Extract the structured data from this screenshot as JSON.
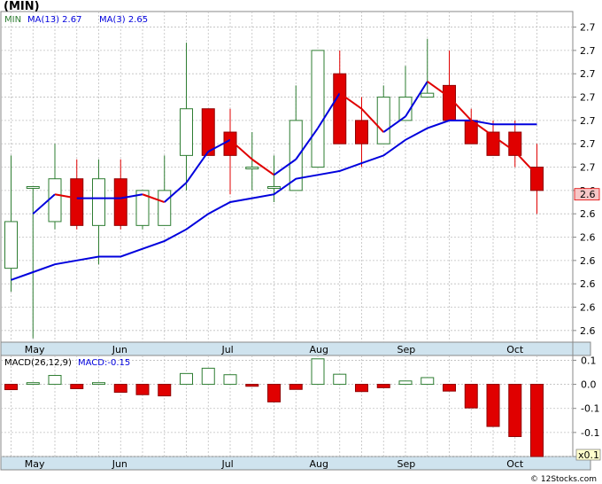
{
  "title": "(MIN)",
  "watermark": "© 12Stocks.com",
  "colors": {
    "up": "#2e7d32",
    "down": "#e00000",
    "ma13": "#0000dd",
    "ma3": "#e00000",
    "grid": "#bfbfbf",
    "axis_band": "#cfe3ee"
  },
  "chart_data": [
    {
      "type": "candlestick",
      "legend": [
        {
          "label": "MIN",
          "color": "#2e7d32"
        },
        {
          "label": "MA(13)",
          "value": "2.67",
          "color": "#0000dd"
        },
        {
          "label": "MA(3)",
          "value": "2.65",
          "color": "#0000dd"
        }
      ],
      "y_tick_labels": [
        "2.7",
        "2.7",
        "2.7",
        "2.7",
        "2.7",
        "2.7",
        "2.7",
        "2.6",
        "2.6",
        "2.6",
        "2.6",
        "2.6",
        "2.6",
        "2.6"
      ],
      "y_tick_values": [
        2.708,
        2.702,
        2.696,
        2.69,
        2.684,
        2.678,
        2.672,
        2.666,
        2.66,
        2.654,
        2.648,
        2.642,
        2.636,
        2.63
      ],
      "ylim": [
        2.627,
        2.712
      ],
      "last_price_label": "2.6",
      "last_price_value": 2.665,
      "x_tick_labels": [
        "May",
        "Jun",
        "Jul",
        "Aug",
        "Sep",
        "Oct"
      ],
      "x_tick_index": [
        1.1,
        5.1,
        10.1,
        14.1,
        18.1,
        23.1
      ],
      "candles": [
        {
          "o": 2.646,
          "h": 2.675,
          "l": 2.64,
          "c": 2.658
        },
        {
          "o": 2.667,
          "h": 2.667,
          "l": 2.628,
          "c": 2.667
        },
        {
          "o": 2.658,
          "h": 2.678,
          "l": 2.656,
          "c": 2.669
        },
        {
          "o": 2.669,
          "h": 2.674,
          "l": 2.656,
          "c": 2.657
        },
        {
          "o": 2.657,
          "h": 2.674,
          "l": 2.647,
          "c": 2.669
        },
        {
          "o": 2.669,
          "h": 2.674,
          "l": 2.656,
          "c": 2.657
        },
        {
          "o": 2.657,
          "h": 2.666,
          "l": 2.656,
          "c": 2.666
        },
        {
          "o": 2.657,
          "h": 2.675,
          "l": 2.657,
          "c": 2.666
        },
        {
          "o": 2.675,
          "h": 2.704,
          "l": 2.666,
          "c": 2.687
        },
        {
          "o": 2.687,
          "h": 2.687,
          "l": 2.675,
          "c": 2.675
        },
        {
          "o": 2.681,
          "h": 2.687,
          "l": 2.665,
          "c": 2.675
        },
        {
          "o": 2.672,
          "h": 2.681,
          "l": 2.666,
          "c": 2.672
        },
        {
          "o": 2.667,
          "h": 2.675,
          "l": 2.663,
          "c": 2.667
        },
        {
          "o": 2.666,
          "h": 2.693,
          "l": 2.666,
          "c": 2.684
        },
        {
          "o": 2.672,
          "h": 2.702,
          "l": 2.672,
          "c": 2.702
        },
        {
          "o": 2.696,
          "h": 2.702,
          "l": 2.678,
          "c": 2.678
        },
        {
          "o": 2.684,
          "h": 2.69,
          "l": 2.672,
          "c": 2.678
        },
        {
          "o": 2.678,
          "h": 2.693,
          "l": 2.678,
          "c": 2.69
        },
        {
          "o": 2.684,
          "h": 2.698,
          "l": 2.684,
          "c": 2.69
        },
        {
          "o": 2.69,
          "h": 2.705,
          "l": 2.69,
          "c": 2.691
        },
        {
          "o": 2.693,
          "h": 2.702,
          "l": 2.684,
          "c": 2.684
        },
        {
          "o": 2.684,
          "h": 2.687,
          "l": 2.678,
          "c": 2.678
        },
        {
          "o": 2.681,
          "h": 2.684,
          "l": 2.675,
          "c": 2.675
        },
        {
          "o": 2.681,
          "h": 2.684,
          "l": 2.672,
          "c": 2.675
        },
        {
          "o": 2.672,
          "h": 2.678,
          "l": 2.66,
          "c": 2.666
        }
      ],
      "ma13": [
        2.643,
        2.645,
        2.647,
        2.648,
        2.649,
        2.649,
        2.651,
        2.653,
        2.656,
        2.66,
        2.663,
        2.664,
        2.665,
        2.669,
        2.67,
        2.671,
        2.673,
        2.675,
        2.679,
        2.682,
        2.684,
        2.684,
        2.683,
        2.683,
        2.683
      ],
      "ma3": [
        null,
        2.66,
        2.665,
        2.664,
        2.664,
        2.664,
        2.665,
        2.663,
        2.668,
        2.676,
        2.679,
        2.674,
        2.67,
        2.674,
        2.682,
        2.691,
        2.687,
        2.681,
        2.685,
        2.694,
        2.69,
        2.684,
        2.68,
        2.676,
        2.67
      ]
    },
    {
      "type": "bar",
      "legend": [
        {
          "label": "MACD(26,12,9)",
          "color": "#000000"
        },
        {
          "label": "MACD:-0.15",
          "color": "#0000dd"
        }
      ],
      "y_tick_labels": [
        "0.1",
        "0.0",
        "-0.1",
        "-0.1",
        "-0.1"
      ],
      "y_tick_values": [
        0.1,
        0.0,
        -0.1,
        -0.2,
        -0.3
      ],
      "ylim": [
        -0.3,
        0.12
      ],
      "scale_badge": "x0.1",
      "x_tick_labels": [
        "May",
        "Jun",
        "Jul",
        "Aug",
        "Sep",
        "Oct"
      ],
      "values": [
        -0.022,
        0.007,
        0.037,
        -0.018,
        0.007,
        -0.033,
        -0.043,
        -0.048,
        0.045,
        0.067,
        0.04,
        -0.008,
        -0.073,
        -0.021,
        0.106,
        0.042,
        -0.03,
        -0.014,
        0.014,
        0.028,
        -0.028,
        -0.098,
        -0.175,
        -0.217,
        -0.3
      ]
    }
  ]
}
